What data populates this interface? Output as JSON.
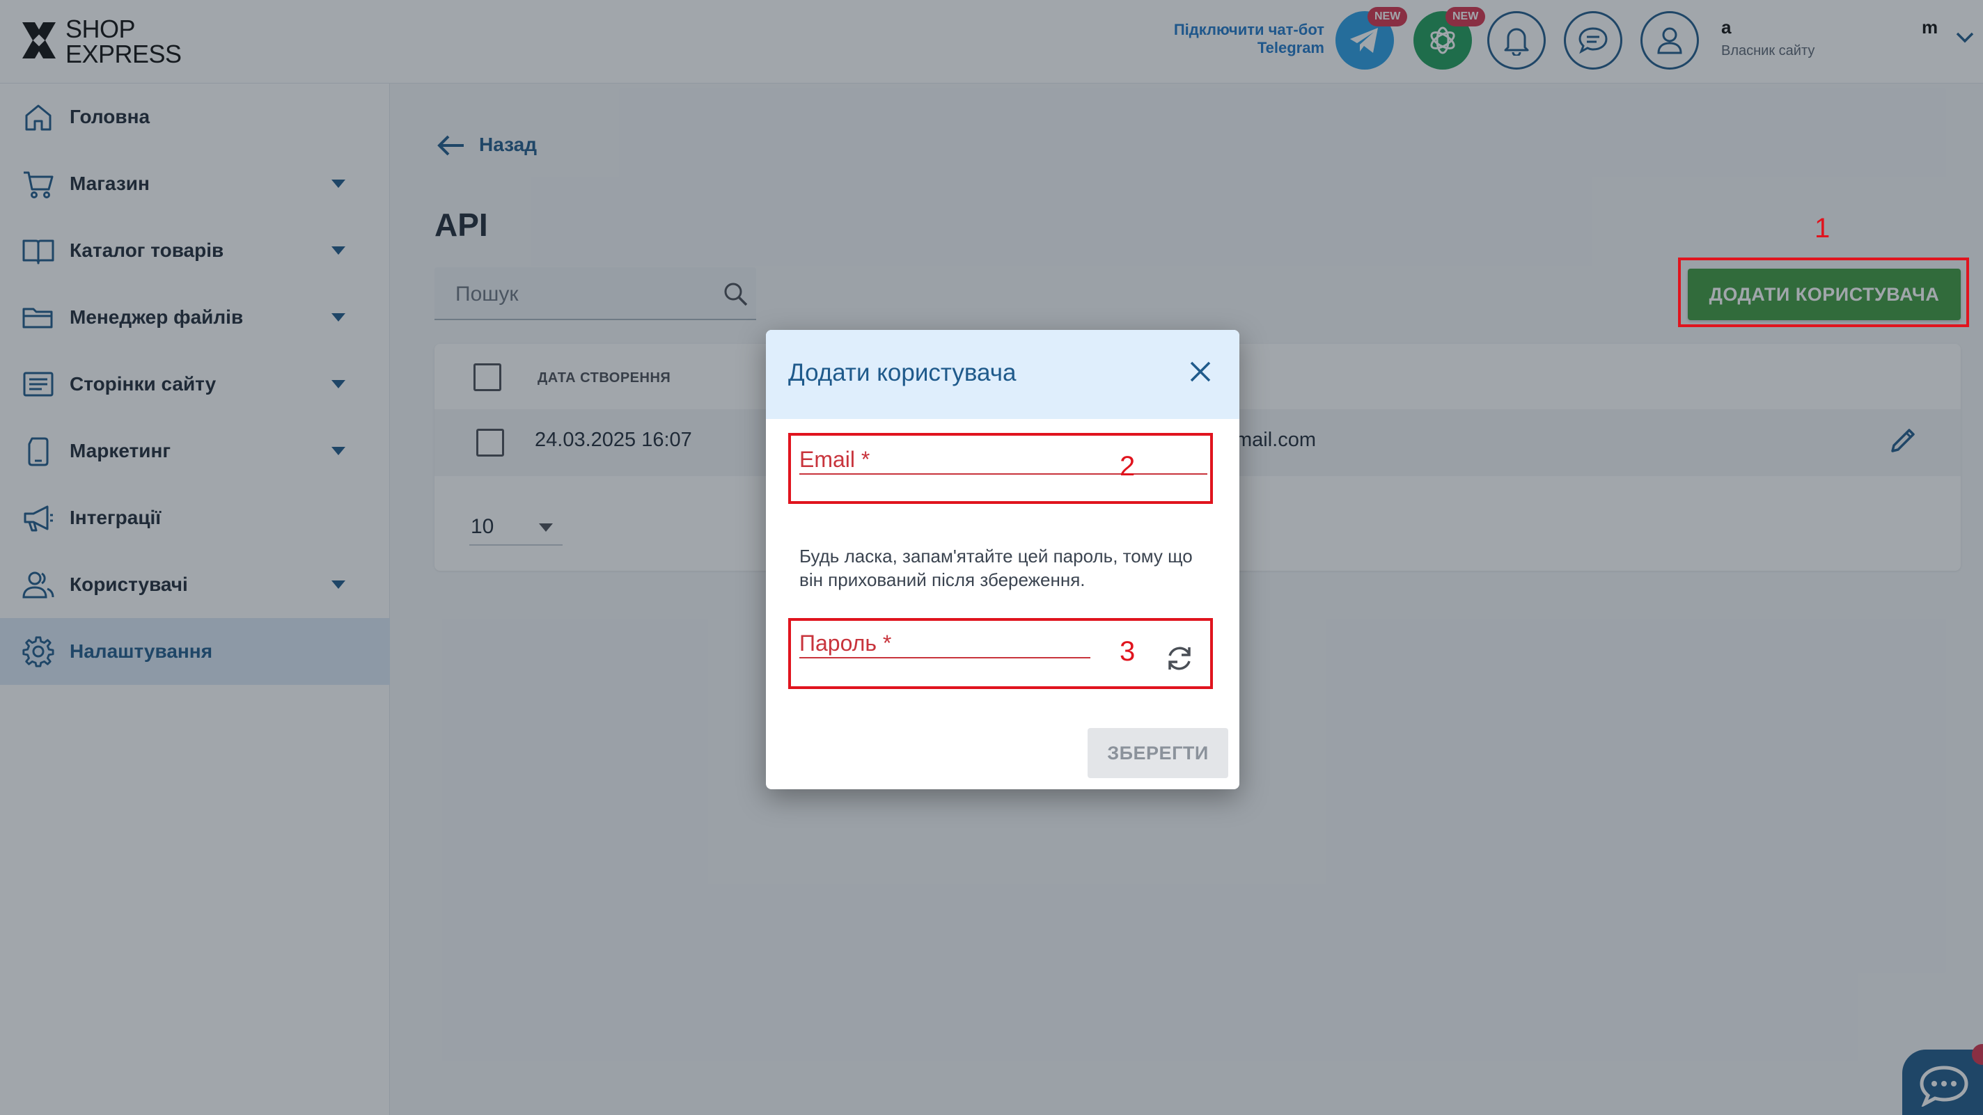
{
  "header": {
    "logo_line1": "SHOP",
    "logo_line2": "EXPRESS",
    "telegram_link_line1": "Підключити чат-бот",
    "telegram_link_line2": "Telegram",
    "badge_new": "NEW",
    "user_name_start": "a",
    "user_name_end": "m",
    "user_role": "Власник сайту",
    "colors": {
      "telegram": "#2a9ee3",
      "gpt": "#1f9d5a",
      "badge": "#d6334c"
    }
  },
  "sidebar": {
    "items": [
      {
        "label": "Головна",
        "icon": "home-icon",
        "has_caret": false,
        "active": false
      },
      {
        "label": "Магазин",
        "icon": "cart-icon",
        "has_caret": true,
        "active": false
      },
      {
        "label": "Каталог товарів",
        "icon": "book-icon",
        "has_caret": true,
        "active": false
      },
      {
        "label": "Менеджер файлів",
        "icon": "folder-icon",
        "has_caret": true,
        "active": false
      },
      {
        "label": "Сторінки сайту",
        "icon": "pages-icon",
        "has_caret": true,
        "active": false
      },
      {
        "label": "Маркетинг",
        "icon": "marketing-icon",
        "has_caret": true,
        "active": false
      },
      {
        "label": "Інтеграції",
        "icon": "megaphone-icon",
        "has_caret": false,
        "active": false
      },
      {
        "label": "Користувачі",
        "icon": "users-icon",
        "has_caret": true,
        "active": false
      },
      {
        "label": "Налаштування",
        "icon": "gear-icon",
        "has_caret": false,
        "active": true
      }
    ]
  },
  "main": {
    "back_label": "Назад",
    "title": "API",
    "search_placeholder": "Пошук",
    "add_user_label": "ДОДАТИ КОРИСТУВАЧА",
    "table": {
      "col_date": "ДАТА СТВОРЕННЯ",
      "rows": [
        {
          "date": "24.03.2025 16:07",
          "email_fragment": "mail.com"
        }
      ]
    },
    "page_size": "10"
  },
  "modal": {
    "title": "Додати користувача",
    "email_label": "Email *",
    "note": "Будь ласка, запам'ятайте цей пароль, тому що він прихований після збереження.",
    "password_label": "Пароль *",
    "save_label": "ЗБЕРЕГТИ"
  },
  "annotations": {
    "n1": "1",
    "n2": "2",
    "n3": "3",
    "color": "#e0141e"
  }
}
